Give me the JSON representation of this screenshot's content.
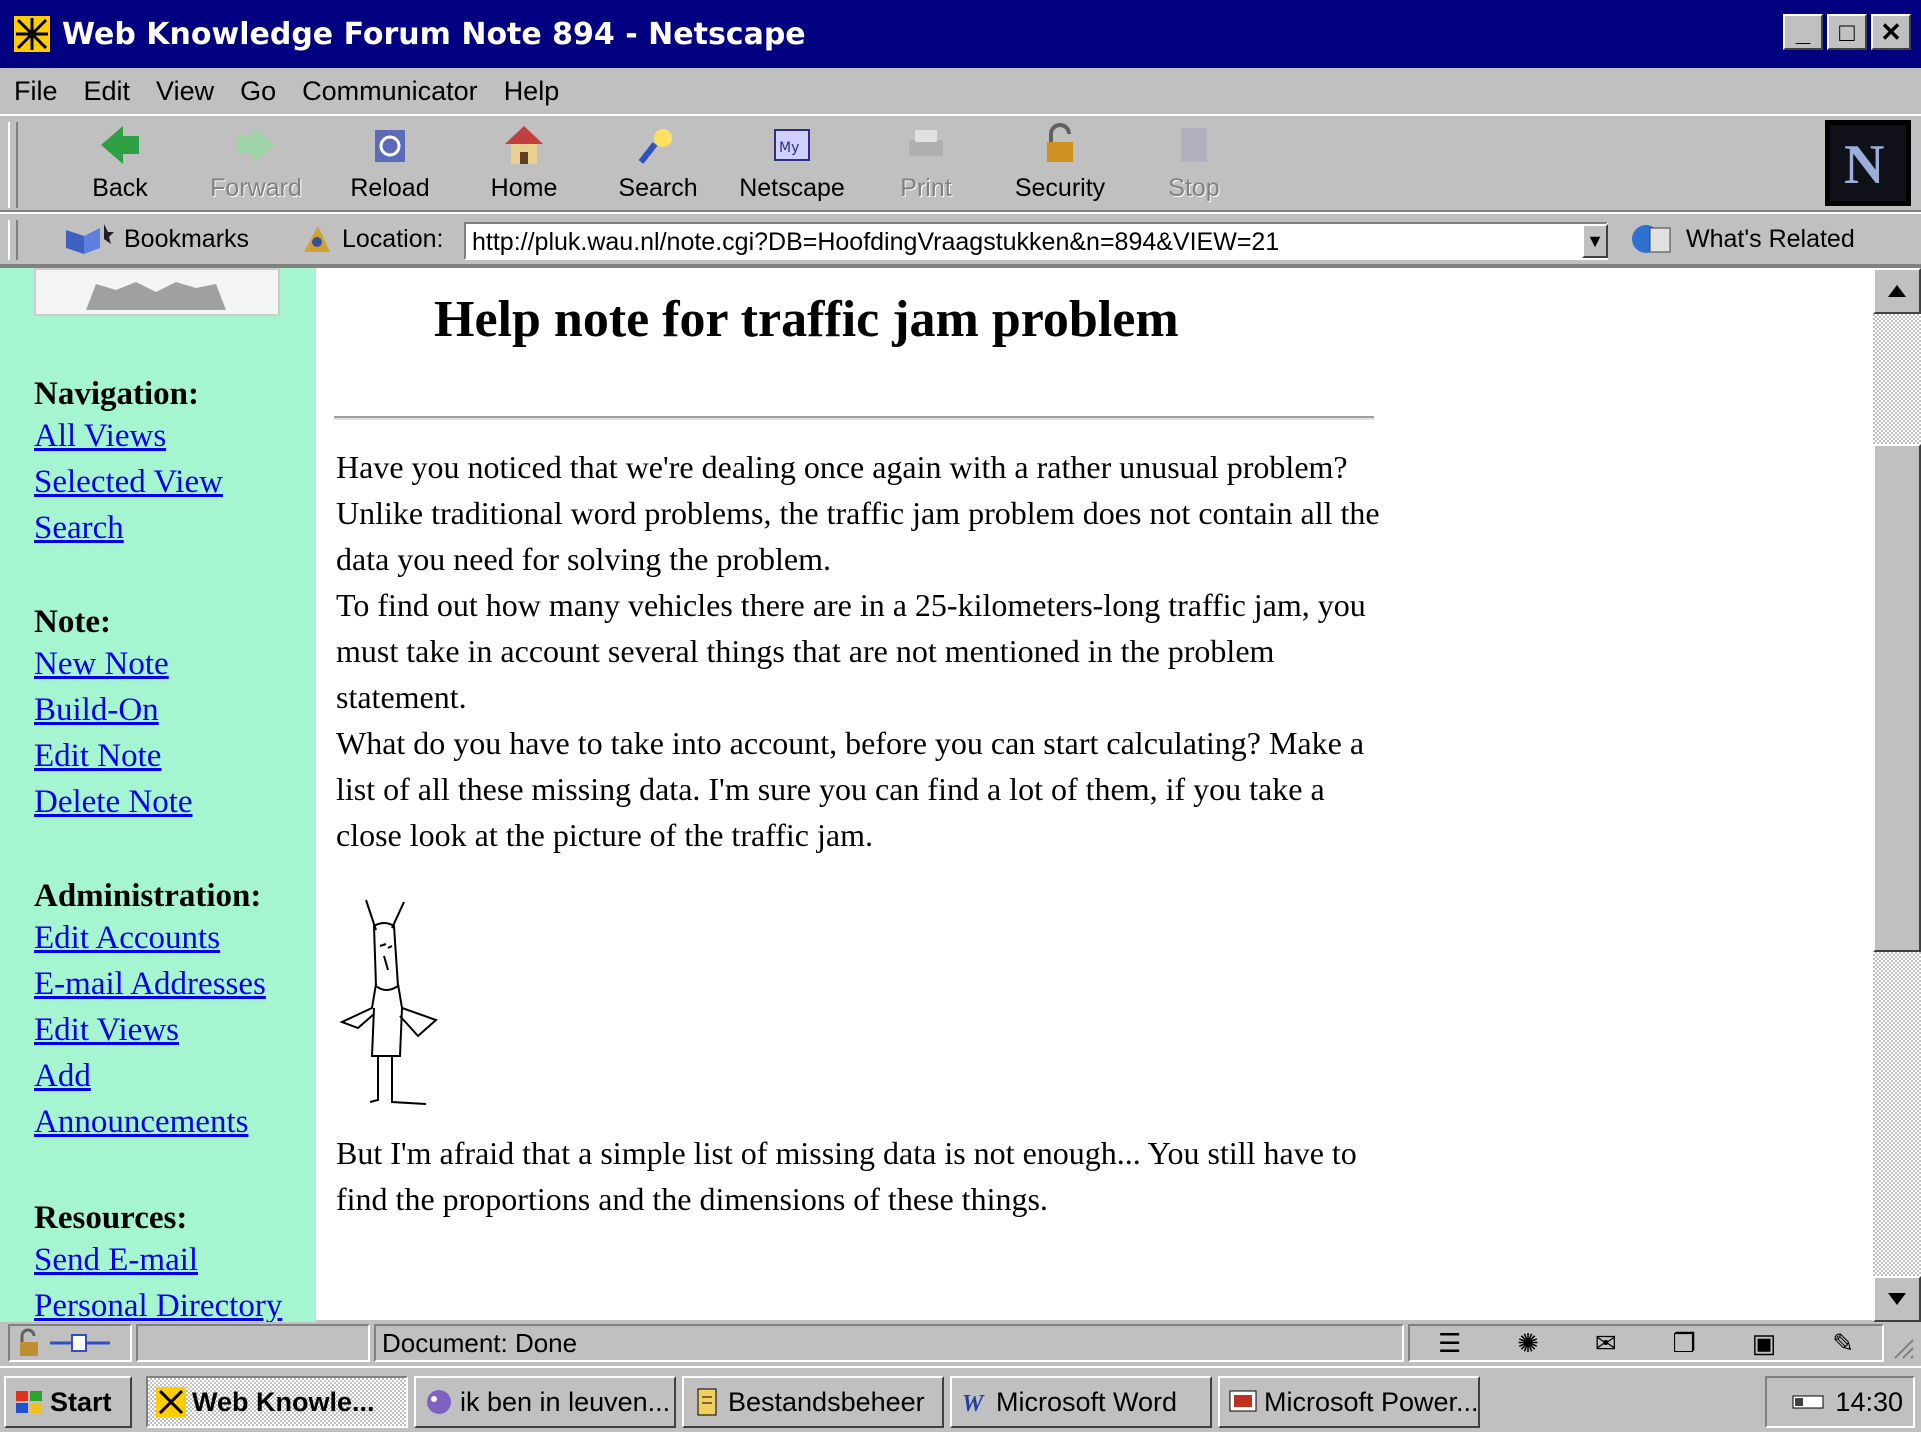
{
  "window": {
    "title": "Web Knowledge Forum Note 894 - Netscape"
  },
  "menu": [
    "File",
    "Edit",
    "View",
    "Go",
    "Communicator",
    "Help"
  ],
  "toolbar": {
    "back": "Back",
    "forward": "Forward",
    "reload": "Reload",
    "home": "Home",
    "search": "Search",
    "netscape": "Netscape",
    "print": "Print",
    "security": "Security",
    "stop": "Stop"
  },
  "location": {
    "bookmarks": "Bookmarks",
    "label": "Location:",
    "url": "http://pluk.wau.nl/note.cgi?DB=HoofdingVraagstukken&n=894&VIEW=21",
    "related": "What's Related"
  },
  "sidebar": {
    "navigation": {
      "heading": "Navigation:",
      "links": [
        "All Views",
        "Selected View",
        "Search"
      ]
    },
    "note": {
      "heading": "Note:",
      "links": [
        "New Note",
        "Build-On",
        "Edit Note",
        "Delete Note"
      ]
    },
    "administration": {
      "heading": "Administration:",
      "links": [
        "Edit Accounts",
        "E-mail Addresses",
        "Edit Views",
        "Add",
        "Announcements"
      ]
    },
    "resources": {
      "heading": "Resources:",
      "links": [
        "Send E-mail",
        "Personal Directory"
      ]
    }
  },
  "main": {
    "title": "Help note for traffic jam problem",
    "para1": "Have you noticed that we're dealing once again with a rather unusual problem? Unlike traditional word problems, the traffic jam problem does not contain all the data you need for solving the problem.",
    "para2": "To find out how many vehicles there are in a 25-kilometers-long traffic jam, you must take in account several things that are not mentioned in the problem statement.",
    "para3": "What do you have to take into account, before you can start calculating? Make a list of all these missing data. I'm sure you can find a lot of them, if you take a close look at the picture of the traffic jam.",
    "para4": "But I'm afraid that a simple list of missing data is not enough... You still have to find the proportions and the dimensions of these things."
  },
  "status": {
    "text": "Document: Done"
  },
  "taskbar": {
    "start": "Start",
    "items": [
      "Web Knowle...",
      "ik ben in leuven...",
      "Bestandsbeheer",
      "Microsoft Word",
      "Microsoft Power..."
    ],
    "clock": "14:30"
  },
  "colors": {
    "titlebar": "#000080",
    "sidebar": "#a5f5d0",
    "link": "#0000ee"
  }
}
